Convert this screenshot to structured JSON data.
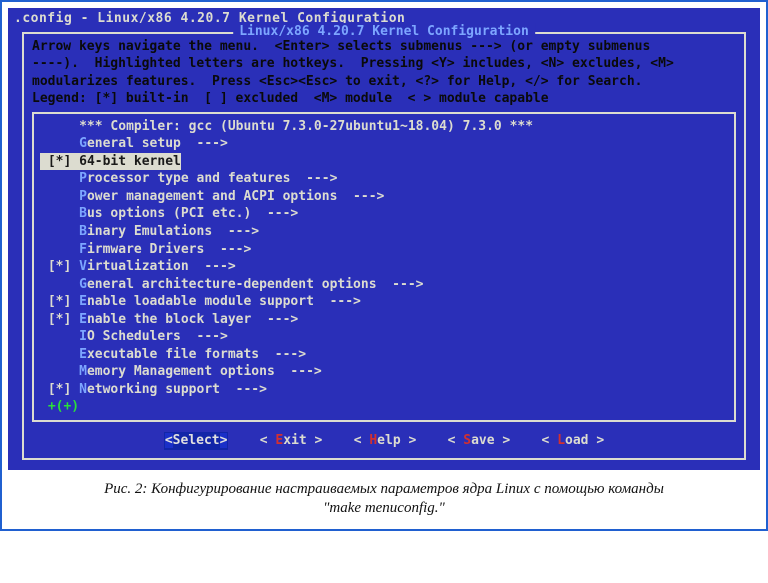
{
  "title": ".config - Linux/x86 4.20.7 Kernel Configuration",
  "panel_caption": "Linux/x86 4.20.7 Kernel Configuration",
  "instructions": [
    "Arrow keys navigate the menu.  <Enter> selects submenus ---> (or empty submenus",
    "----).  Highlighted letters are hotkeys.  Pressing <Y> includes, <N> excludes, <M>",
    "modularizes features.  Press <Esc><Esc> to exit, <?> for Help, </> for Search.",
    "Legend: [*] built-in  [ ] excluded  <M> module  < > module capable"
  ],
  "compiler_banner": "*** Compiler: gcc (Ubuntu 7.3.0-27ubuntu1~18.04) 7.3.0 ***",
  "menu": [
    {
      "marker": "",
      "hot": "G",
      "rest": "eneral setup  --->",
      "selected": false
    },
    {
      "marker": "[*]",
      "hot": "6",
      "rest": "4-bit kernel",
      "selected": true
    },
    {
      "marker": "",
      "hot": "P",
      "rest": "rocessor type and features  --->",
      "selected": false
    },
    {
      "marker": "",
      "hot": "P",
      "rest": "ower management and ACPI options  --->",
      "selected": false
    },
    {
      "marker": "",
      "hot": "B",
      "rest": "us options (PCI etc.)  --->",
      "selected": false
    },
    {
      "marker": "",
      "hot": "B",
      "rest": "inary Emulations  --->",
      "selected": false
    },
    {
      "marker": "",
      "hot": "F",
      "rest": "irmware Drivers  --->",
      "selected": false
    },
    {
      "marker": "[*]",
      "hot": "V",
      "rest": "irtualization  --->",
      "selected": false
    },
    {
      "marker": "",
      "hot": "G",
      "rest": "eneral architecture-dependent options  --->",
      "selected": false
    },
    {
      "marker": "[*]",
      "hot": "E",
      "rest": "nable loadable module support  --->",
      "selected": false
    },
    {
      "marker": "[*]",
      "hot": "E",
      "rest": "nable the block layer  --->",
      "selected": false
    },
    {
      "marker": "",
      "hot": "I",
      "rest": "O Schedulers  --->",
      "selected": false
    },
    {
      "marker": "",
      "hot": "E",
      "rest": "xecutable file formats  --->",
      "selected": false
    },
    {
      "marker": "",
      "hot": "M",
      "rest": "emory Management options  --->",
      "selected": false
    },
    {
      "marker": "[*]",
      "hot": "N",
      "rest": "etworking support  --->",
      "selected": false
    }
  ],
  "cursor_tail": "+(+)",
  "buttons": {
    "select": {
      "hot": "S",
      "rest": "elect",
      "selected": true
    },
    "exit": {
      "hot": "E",
      "rest": "xit",
      "selected": false
    },
    "help": {
      "hot": "H",
      "rest": "elp",
      "selected": false
    },
    "save": {
      "hot": "S",
      "rest": "ave",
      "selected": false
    },
    "load": {
      "hot": "L",
      "rest": "oad",
      "selected": false
    }
  },
  "figure_caption_l1": "Рис. 2: Конфигурирование настраиваемых параметров ядра Linux с помощью команды",
  "figure_caption_l2": "\"make menuconfig.\""
}
